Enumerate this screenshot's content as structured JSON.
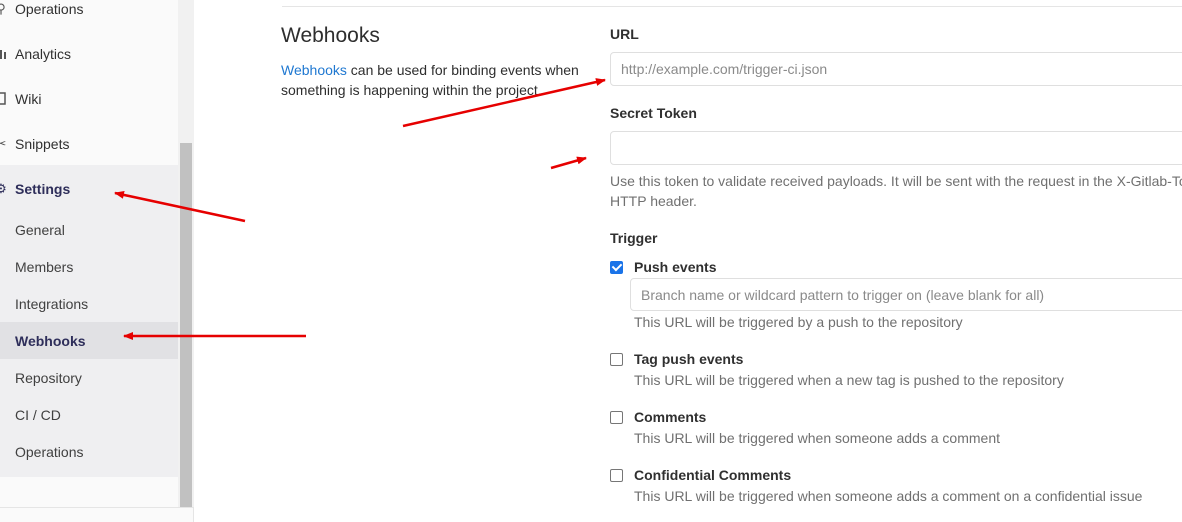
{
  "sidebar": {
    "items": [
      {
        "label": "Operations",
        "icon": "rocket-icon"
      },
      {
        "label": "Analytics",
        "icon": "chart-icon"
      },
      {
        "label": "Wiki",
        "icon": "book-icon"
      },
      {
        "label": "Snippets",
        "icon": "scissors-icon"
      },
      {
        "label": "Settings",
        "icon": "gear-icon"
      }
    ],
    "settings_sub": [
      {
        "label": "General"
      },
      {
        "label": "Members"
      },
      {
        "label": "Integrations"
      },
      {
        "label": "Webhooks"
      },
      {
        "label": "Repository"
      },
      {
        "label": "CI / CD"
      },
      {
        "label": "Operations"
      }
    ]
  },
  "section": {
    "title": "Webhooks",
    "desc_link": "Webhooks",
    "desc_rest": " can be used for binding events when something is happening within the project."
  },
  "form": {
    "url_label": "URL",
    "url_placeholder": "http://example.com/trigger-ci.json",
    "token_label": "Secret Token",
    "token_value": "",
    "token_help_1": "Use this token to validate received payloads. It will be sent with the request in the X-Gitlab-To",
    "token_help_2": "HTTP header.",
    "trigger_label": "Trigger",
    "triggers": [
      {
        "label": "Push events",
        "checked": true,
        "help": "This URL will be triggered by a push to the repository"
      },
      {
        "label": "Tag push events",
        "checked": false,
        "help": "This URL will be triggered when a new tag is pushed to the repository"
      },
      {
        "label": "Comments",
        "checked": false,
        "help": "This URL will be triggered when someone adds a comment"
      },
      {
        "label": "Confidential Comments",
        "checked": false,
        "help": "This URL will be triggered when someone adds a comment on a confidential issue"
      }
    ],
    "branch_placeholder": "Branch name or wildcard pattern to trigger on (leave blank for all)"
  },
  "colors": {
    "accent": "#1f78d1",
    "annotation_arrow": "#e60000",
    "checkbox": "#1a73e8"
  }
}
